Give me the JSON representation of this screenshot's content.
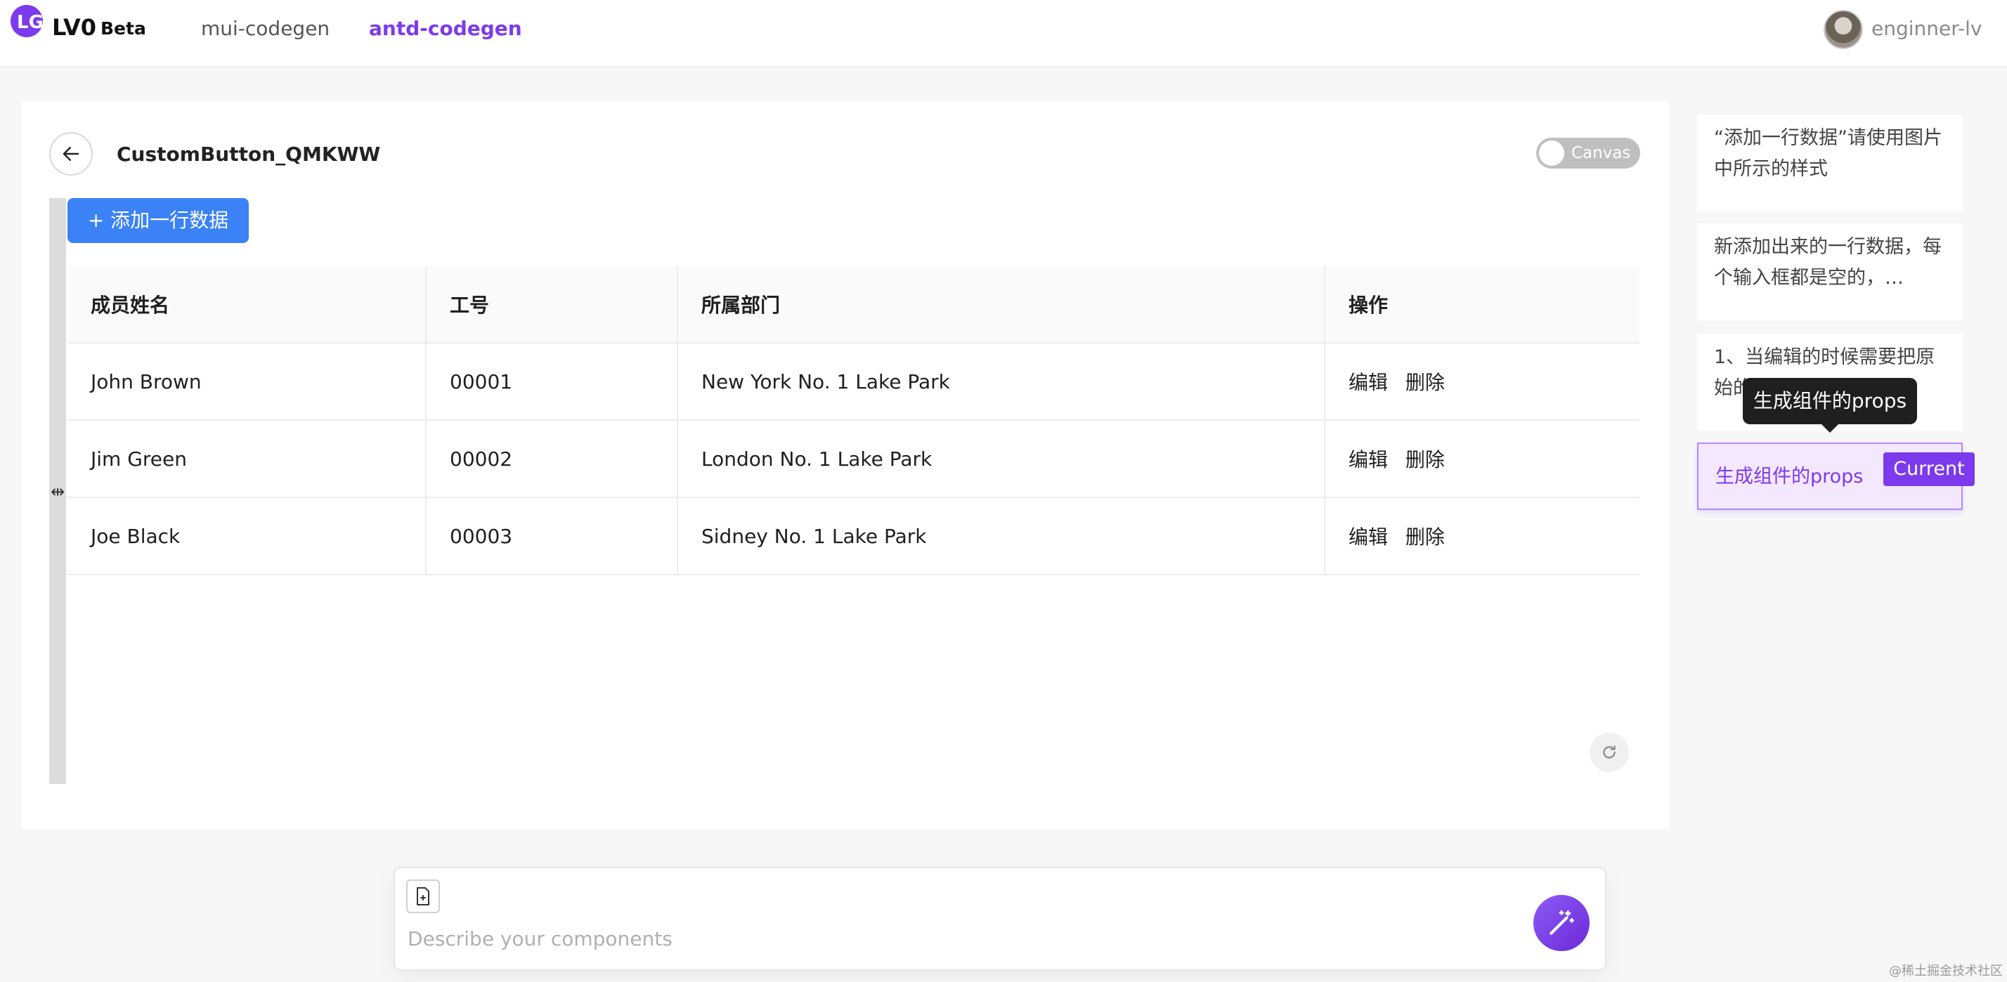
{
  "nav": {
    "brand": "LV0",
    "brand_badge": "Beta",
    "links": [
      "mui-codegen",
      "antd-codegen"
    ],
    "active_link": "antd-codegen",
    "user": "enginner-lv"
  },
  "editor": {
    "component_title": "CustomButton_QMKWW",
    "canvas_toggle_label": "Canvas",
    "add_row_label": "+ 添加一行数据"
  },
  "table": {
    "columns": [
      "成员姓名",
      "工号",
      "所属部门",
      "操作"
    ],
    "rows": [
      {
        "name": "John Brown",
        "id": "00001",
        "dept": "New York No. 1 Lake Park"
      },
      {
        "name": "Jim Green",
        "id": "00002",
        "dept": "London No. 1 Lake Park"
      },
      {
        "name": "Joe Black",
        "id": "00003",
        "dept": "Sidney No. 1 Lake Park"
      }
    ],
    "actions": [
      "编辑",
      "删除"
    ]
  },
  "history": {
    "items": [
      "“添加一行数据”请使用图片中所示的样式",
      "新添加出来的一行数据，每个输入框都是空的，…",
      "1、当编辑的时候需要把原始的…",
      "生成组件的props"
    ],
    "current_badge": "Current",
    "tooltip": "生成组件的props"
  },
  "composer": {
    "placeholder": "Describe your components"
  },
  "watermark": "@稀土掘金技术社区",
  "colors": {
    "accent": "#7c3aed",
    "primary_button": "#3b82f6"
  }
}
